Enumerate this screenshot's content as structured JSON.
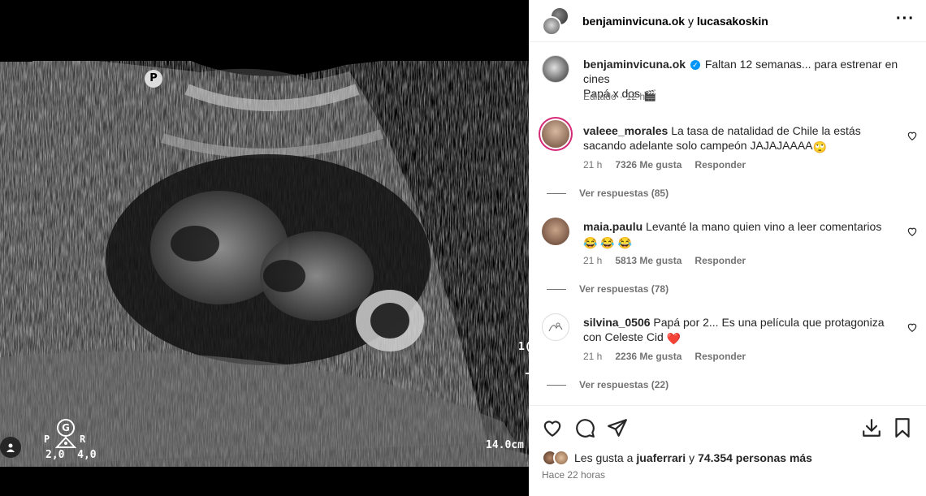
{
  "media": {
    "marker_p": "P",
    "probe_g": "G",
    "probe_p": "P",
    "probe_r": "R",
    "probe_values": "2,0  4,0",
    "depth_label": "14.0cm",
    "side_label_top": "1(",
    "side_label_bottom": "-"
  },
  "header": {
    "user1": "benjaminvicuna.ok",
    "connector": "y",
    "user2": "lucasakoskin"
  },
  "caption": {
    "username": "benjaminvicuna.ok",
    "text_line1": "Faltan 12 semanas... para estrenar en cines",
    "text_line2": "Papá x dos",
    "edited": "Editado",
    "time": "12 h"
  },
  "comments": [
    {
      "username": "valeee_morales",
      "text": "La tasa de natalidad de Chile la estás sacando adelante solo campeón JAJAJAAAA",
      "emoji": "🙄",
      "time": "21 h",
      "likes": "7326 Me gusta",
      "reply": "Responder",
      "view_replies": "Ver respuestas (85)"
    },
    {
      "username": "maia.paulu",
      "text": "Levanté la mano quien vino a leer comentarios",
      "emoji": "😂 😂 😂",
      "time": "21 h",
      "likes": "5813 Me gusta",
      "reply": "Responder",
      "view_replies": "Ver respuestas (78)"
    },
    {
      "username": "silvina_0506",
      "text": "Papá por 2... Es una película que protagoniza con Celeste Cid",
      "emoji": "❤️",
      "time": "21 h",
      "likes": "2236 Me gusta",
      "reply": "Responder",
      "view_replies": "Ver respuestas (22)"
    }
  ],
  "likes": {
    "prefix": "Les gusta a",
    "user": "juaferrari",
    "connector": "y",
    "others": "74.354 personas más"
  },
  "posted": "Hace 22 horas",
  "icons": {
    "like": "heart-icon",
    "comment": "comment-icon",
    "share": "send-icon",
    "download": "download-icon",
    "save": "bookmark-icon",
    "more": "more-icon"
  },
  "colors": {
    "verified": "#0095f6",
    "heart_red": "#ed4956",
    "muted": "#737373"
  }
}
